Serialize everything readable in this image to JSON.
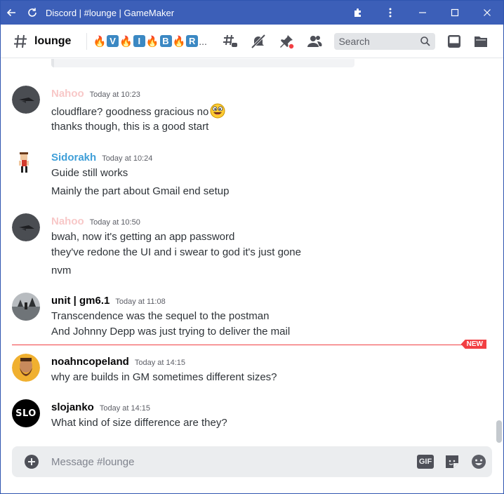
{
  "window": {
    "title": "Discord | #lounge | GameMaker"
  },
  "header": {
    "channel_name": "lounge",
    "topic_letters": [
      "V",
      "I",
      "B",
      "R"
    ],
    "topic_ellipsis": "...",
    "search_placeholder": "Search"
  },
  "messages": [
    {
      "author": "Nahoo",
      "author_color": "#f8c8c8",
      "timestamp": "Today at 10:23",
      "lines": [
        "cloudflare? goodness gracious no",
        "thanks though, this is a good start"
      ],
      "avatar_icon": "dark-bird-avatar"
    },
    {
      "author": "Sidorakh",
      "author_color": "#3f9fd8",
      "timestamp": "Today at 10:24",
      "lines": [
        "Guide still works",
        "Mainly the part about Gmail end setup"
      ],
      "avatar_icon": "pixel-character-avatar"
    },
    {
      "author": "Nahoo",
      "author_color": "#f8c8c8",
      "timestamp": "Today at 10:50",
      "lines": [
        "bwah, now it's getting an app password",
        "they've redone the UI and i swear to god it's just gone",
        "nvm"
      ],
      "avatar_icon": "dark-bird-avatar"
    },
    {
      "author": "unit | gm6.1",
      "author_color": "#060607",
      "timestamp": "Today at 11:08",
      "lines": [
        "Transcendence was the sequel to the postman",
        "And Johnny Depp was just trying to deliver the mail"
      ],
      "avatar_icon": "landscape-avatar"
    },
    {
      "author": "noahncopeland",
      "author_color": "#060607",
      "timestamp": "Today at 14:15",
      "lines": [
        "why are builds in GM sometimes different sizes?"
      ],
      "avatar_icon": "bearded-man-avatar"
    },
    {
      "author": "slojanko",
      "author_color": "#060607",
      "timestamp": "Today at 14:15",
      "lines": [
        "What kind of size difference are they?"
      ],
      "avatar_icon": "slo-logo-avatar",
      "avatar_text": "SLO"
    }
  ],
  "new_badge": "NEW",
  "composer": {
    "placeholder": "Message #lounge",
    "gif_label": "GIF"
  },
  "colors": {
    "titlebar": "#3c5fb8",
    "new_divider": "#f23f43",
    "link_blue": "#3f9fd8"
  }
}
